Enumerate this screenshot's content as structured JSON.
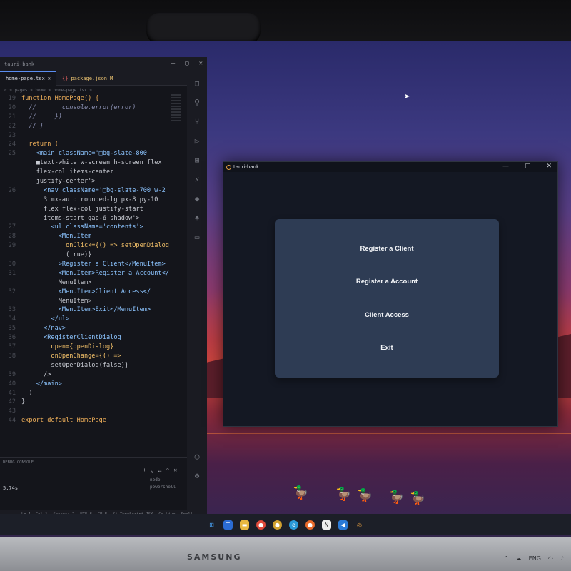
{
  "vscode": {
    "window_title": "tauri-bank",
    "tabs": [
      {
        "label": "home-page.tsx",
        "active": true
      },
      {
        "label": "package.json",
        "badge": "M"
      }
    ],
    "breadcrumb": "c > pages > home > home-page.tsx > ...",
    "code_lines": [
      {
        "n": "19",
        "text": "function HomePage() {"
      },
      {
        "n": "20",
        "text": "  //       console.error(error)"
      },
      {
        "n": "21",
        "text": "  //     })"
      },
      {
        "n": "22",
        "text": "  // }"
      },
      {
        "n": "23",
        "text": ""
      },
      {
        "n": "24",
        "text": "  return ("
      },
      {
        "n": "25",
        "text": "    <main className='□bg-slate-800"
      },
      {
        "n": "",
        "text": "    ■text-white w-screen h-screen flex"
      },
      {
        "n": "",
        "text": "    flex-col items-center"
      },
      {
        "n": "",
        "text": "    justify-center'>"
      },
      {
        "n": "26",
        "text": "      <nav className='□bg-slate-700 w-2"
      },
      {
        "n": "",
        "text": "      3 mx-auto rounded-lg px-8 py-10"
      },
      {
        "n": "",
        "text": "      flex flex-col justify-start"
      },
      {
        "n": "",
        "text": "      items-start gap-6 shadow'>"
      },
      {
        "n": "27",
        "text": "        <ul className='contents'>"
      },
      {
        "n": "28",
        "text": "          <MenuItem"
      },
      {
        "n": "29",
        "text": "            onClick={() => setOpenDialog"
      },
      {
        "n": "",
        "text": "            (true)}"
      },
      {
        "n": "30",
        "text": "          >Register a Client</MenuItem>"
      },
      {
        "n": "31",
        "text": "          <MenuItem>Register a Account</"
      },
      {
        "n": "",
        "text": "          MenuItem>"
      },
      {
        "n": "32",
        "text": "          <MenuItem>Client Access</"
      },
      {
        "n": "",
        "text": "          MenuItem>"
      },
      {
        "n": "33",
        "text": "          <MenuItem>Exit</MenuItem>"
      },
      {
        "n": "34",
        "text": "        </ul>"
      },
      {
        "n": "35",
        "text": "      </nav>"
      },
      {
        "n": "36",
        "text": "      <RegisterClientDialog"
      },
      {
        "n": "37",
        "text": "        open={openDialog}"
      },
      {
        "n": "38",
        "text": "        onOpenChange={() =>"
      },
      {
        "n": "",
        "text": "        setOpenDialog(false)}"
      },
      {
        "n": "39",
        "text": "      />"
      },
      {
        "n": "40",
        "text": "    </main>"
      },
      {
        "n": "41",
        "text": "  )"
      },
      {
        "n": "42",
        "text": "}"
      },
      {
        "n": "43",
        "text": ""
      },
      {
        "n": "44",
        "text": "export default HomePage"
      }
    ],
    "panel_label": "DEBUG CONSOLE",
    "terminal_time": "5.74s",
    "terminals": [
      "node",
      "powershell"
    ],
    "statusbar": [
      "Ln 1, Col 1",
      "Spaces: 2",
      "UTF-8",
      "CRLF",
      "{} TypeScript JSX",
      "Go Live",
      "Spell"
    ]
  },
  "tauri": {
    "title": "tauri-bank",
    "menu": [
      "Register a Client",
      "Register a Account",
      "Client Access",
      "Exit"
    ]
  },
  "monitor": {
    "brand": "SAMSUNG"
  },
  "tray": {
    "lang": "ENG"
  },
  "colors": {
    "accent": "#5a8df0",
    "nav_bg": "#2e3c54",
    "main_bg": "#141823"
  }
}
